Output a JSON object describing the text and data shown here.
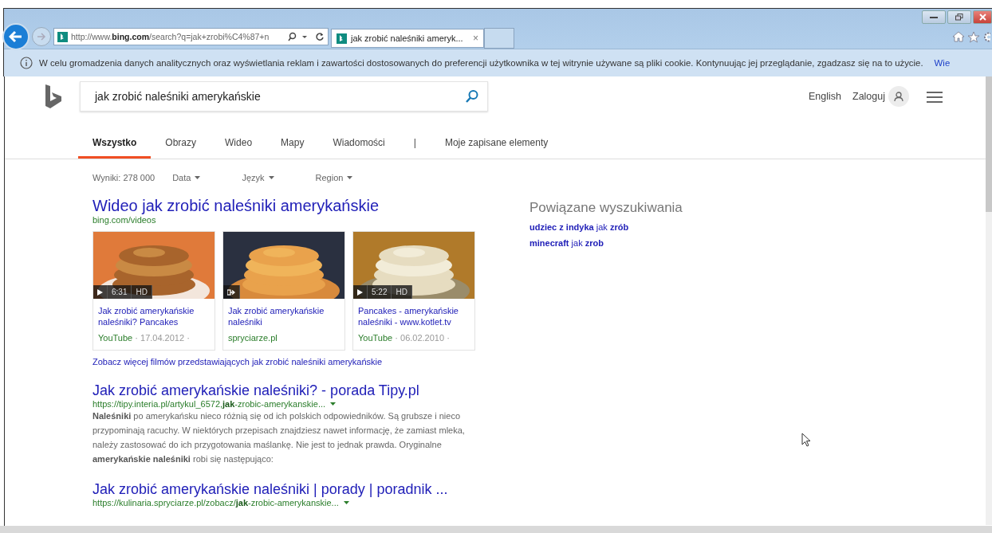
{
  "browser": {
    "address": "http://www.**bing.com**/search?q=jak+zrobi%C4%87+n",
    "tabs": [
      {
        "title": "jak zrobić naleśniki ameryk...",
        "close": "×",
        "selected": true
      }
    ]
  },
  "info_bar": {
    "text": "W celu gromadzenia danych analitycznych oraz wyświetlania reklam i zawartości dostosowanych do preferencji użytkownika w tej witrynie używane są pliki cookie. Kontynuując jej przeglądanie, zgadzasz się na to użycie.",
    "link": "Wie"
  },
  "search": {
    "value": "jak zrobić naleśniki amerykańskie"
  },
  "header_links": [
    "English",
    "Zaloguj"
  ],
  "nav_tabs": [
    {
      "label": "Wszystko",
      "selected": true
    },
    {
      "label": "Obrazy",
      "selected": false
    },
    {
      "label": "Wideo",
      "selected": false
    },
    {
      "label": "Mapy",
      "selected": false
    },
    {
      "label": "Wiadomości",
      "selected": false
    },
    {
      "label": "|",
      "selected": false
    },
    {
      "label": "Moje zapisane elementy",
      "selected": false
    }
  ],
  "results_count": "Wyniki: 278 000",
  "filters": [
    "Data",
    "Język",
    "Region"
  ],
  "video_section": {
    "title": "Wideo jak zrobić naleśniki amerykańskie",
    "source": "bing.com/videos",
    "videos": [
      {
        "kind": "play",
        "duration": "6:31",
        "hd": "HD",
        "title": "Jak zrobić amerykańskie naleśniki? Pancakes",
        "source": "YouTube",
        "date": "· 17.04.2012 ·"
      },
      {
        "kind": "share",
        "title": "Jak zrobić amerykańskie naleśniki",
        "source": "spryciarze.pl"
      },
      {
        "kind": "play",
        "duration": "5:22",
        "hd": "HD",
        "title": "Pancakes - amerykańskie naleśniki - www.kotlet.tv",
        "source": "YouTube",
        "date": "· 06.02.2010 ·"
      }
    ],
    "more": "Zobacz więcej filmów przedstawiających jak zrobić naleśniki amerykańskie"
  },
  "results": [
    {
      "title": "Jak zrobić amerykańskie naleśniki? - porada Tipy.pl",
      "url": "https://tipy.interia.pl/artykul_6572,**jak**-zrobic-amerykanskie...",
      "snippet": "**Naleśniki** po amerykańsku nieco różnią się od ich polskich odpowiedników. Są grubsze i nieco przypominają racuchy. W niektórych przepisach znajdziesz nawet informację, że zamiast mleka, należy zastosować do ich przygotowania maślankę. Nie jest to jednak prawda. Oryginalne **amerykańskie naleśniki** robi się następująco:"
    },
    {
      "title": "Jak zrobić amerykańskie naleśniki | porady | poradnik ...",
      "url": "https://kulinaria.spryciarze.pl/zobacz/**jak**-zrobic-amerykanskie..."
    }
  ],
  "related": {
    "title": "Powiązane wyszukiwania",
    "items": [
      "**udziec z indyka** jak **zrób**",
      "**minecraft** jak **zrob**"
    ]
  }
}
